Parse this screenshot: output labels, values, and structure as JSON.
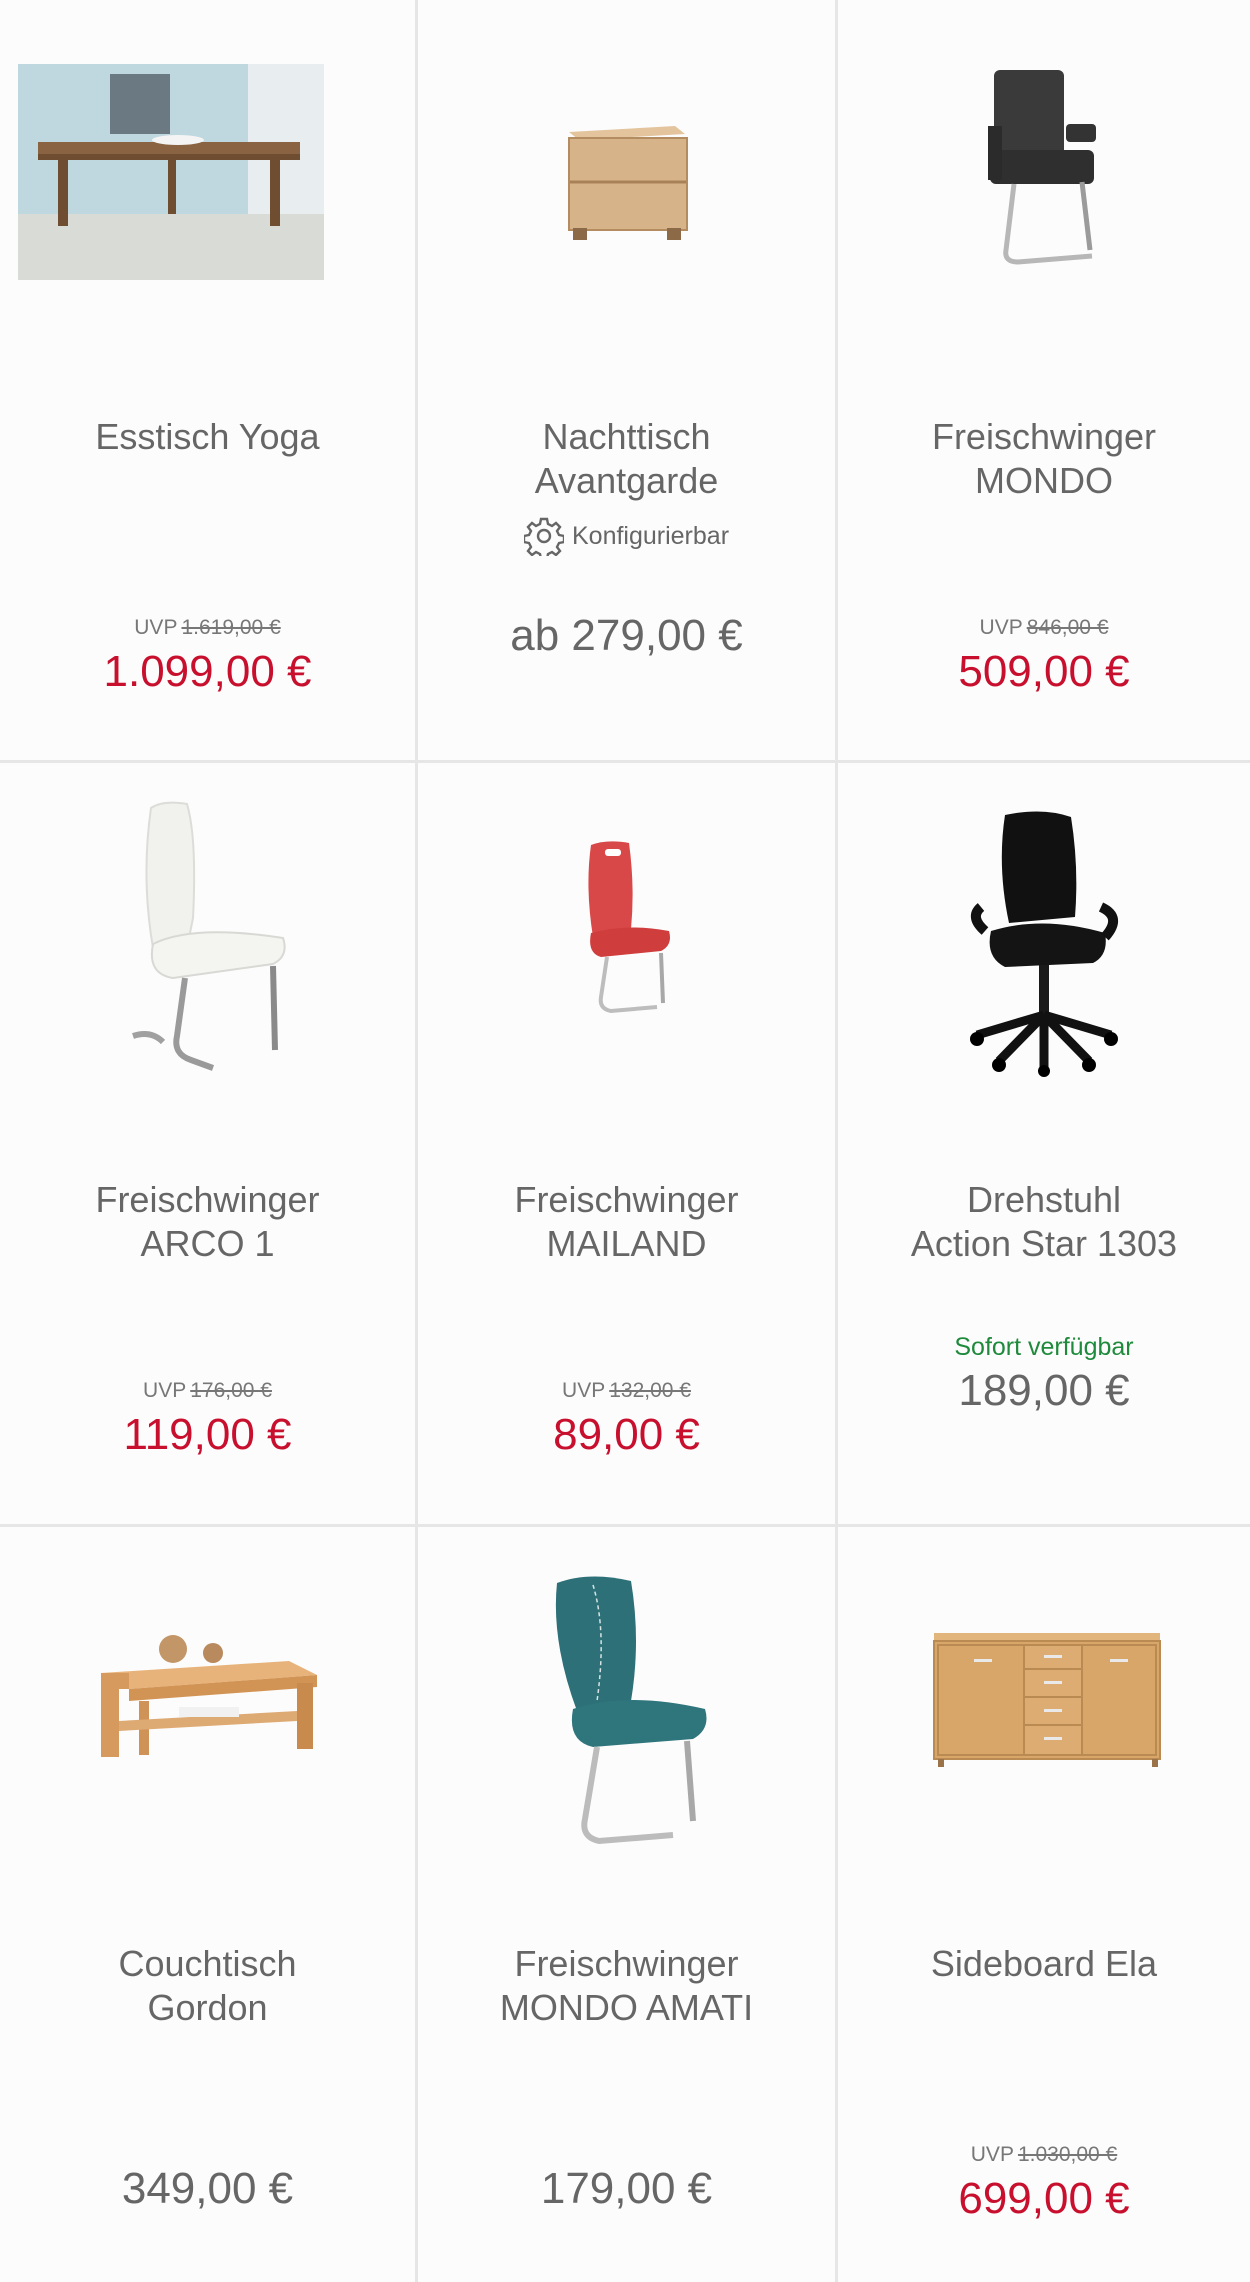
{
  "products": [
    {
      "name": "Esstisch Yoga",
      "image": "dining-table-image",
      "uvp_label": "UVP",
      "uvp_price": "1.619,00 €",
      "price": "1.099,00 €"
    },
    {
      "name": "Nachttisch\nAvantgarde",
      "image": "nightstand-image",
      "config_label": "Konfigurierbar",
      "config_icon": "gear-icon",
      "price": "ab 279,00 €"
    },
    {
      "name": "Freischwinger\nMONDO",
      "image": "cantilever-armchair-image",
      "uvp_label": "UVP",
      "uvp_price": "846,00 €",
      "price": "509,00 €"
    },
    {
      "name": "Freischwinger\nARCO 1",
      "image": "white-cantilever-chair-image",
      "uvp_label": "UVP",
      "uvp_price": "176,00 €",
      "price": "119,00 €"
    },
    {
      "name": "Freischwinger\nMAILAND",
      "image": "red-cantilever-chair-image",
      "uvp_label": "UVP",
      "uvp_price": "132,00 €",
      "price": "89,00 €"
    },
    {
      "name": "Drehstuhl\nAction Star 1303",
      "image": "office-chair-image",
      "availability": "Sofort verfügbar",
      "price": "189,00 €"
    },
    {
      "name": "Couchtisch\nGordon",
      "image": "coffee-table-image",
      "price": "349,00 €"
    },
    {
      "name": "Freischwinger\nMONDO AMATI",
      "image": "teal-cantilever-chair-image",
      "price": "179,00 €"
    },
    {
      "name": "Sideboard Ela",
      "image": "sideboard-image",
      "uvp_label": "UVP",
      "uvp_price": "1.030,00 €",
      "price": "699,00 €"
    }
  ],
  "colors": {
    "sale_price": "#c8102e",
    "regular_price": "#666666",
    "availability": "#1f8a3c",
    "divider": "#e6e6e6"
  }
}
